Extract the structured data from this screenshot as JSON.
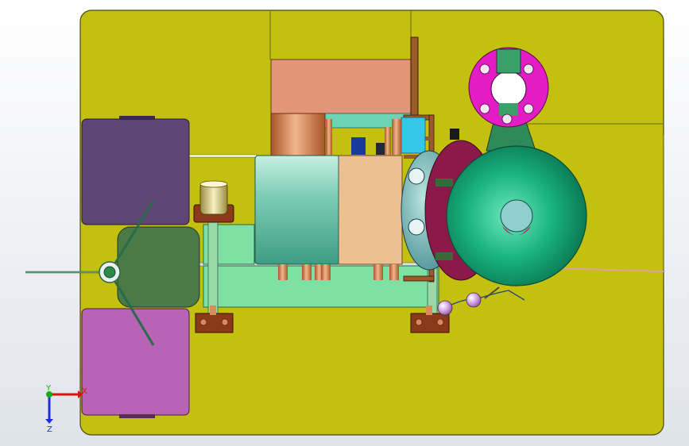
{
  "view": {
    "background_top": "#ffffff",
    "background_bottom": "#dfe3ea"
  },
  "colors": {
    "base_plate": "#c3c010",
    "plate_edge": "#4a4a10",
    "purple_block": "#5e4674",
    "magenta_block": "#b764b6",
    "dark_green_block": "#4a7a46",
    "light_green": "#7fe0a4",
    "salmon": "#e3957a",
    "peach": "#edc092",
    "copper": "#d98b5a",
    "teal_cylinder": "#7fcfb6",
    "hub_magenta": "#e41cc6",
    "cone_green": "#1fbf88",
    "dark_brown": "#8a3a1a",
    "maroon": "#8b1a4a"
  },
  "triad": {
    "x_label": "X",
    "y_label": "Y",
    "z_label": "Z",
    "x_color": "#e01010",
    "y_color": "#10b010",
    "z_color": "#2030e0"
  },
  "icons": {
    "fan_rotor": "propeller-icon",
    "coordinate_triad": "axis-triad-icon",
    "flange_hub": "flange-icon"
  }
}
